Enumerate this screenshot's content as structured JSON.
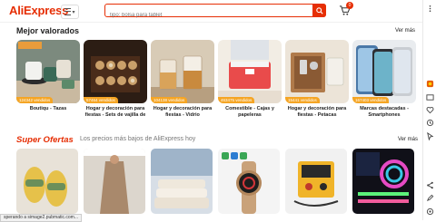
{
  "header": {
    "logo": "AliExpress",
    "search_placeholder": "tipo: bolsa para tablet",
    "cart_count": "0"
  },
  "section1": {
    "title": "Mejor valorados",
    "more": "Ver más",
    "items": [
      {
        "name": "Boutiqu - Tazas",
        "sold": "124342 vendidos"
      },
      {
        "name": "Hogar y decoración para fiestas - Sets de vajilla de",
        "sold": "57464 vendidos"
      },
      {
        "name": "Hogar y decoración para fiestas - Vidrio",
        "sold": "104138 vendidos"
      },
      {
        "name": "Comestible - Cajas y papeleras",
        "sold": "463475 vendidos"
      },
      {
        "name": "Hogar y decoración para fiestas - Petacas",
        "sold": "15441 vendidos"
      },
      {
        "name": "Marcas destacadas - Smartphones",
        "sold": "167403 vendidos"
      }
    ]
  },
  "section2": {
    "title": "Super Ofertas",
    "subtitle": "Los precios más bajos de AliExpress hoy",
    "more": "Ver más"
  },
  "status_text": "sperando a simage2.pubmatic.com...",
  "colors": {
    "accent": "#e62e04",
    "sold_badge": "#f5a524"
  }
}
